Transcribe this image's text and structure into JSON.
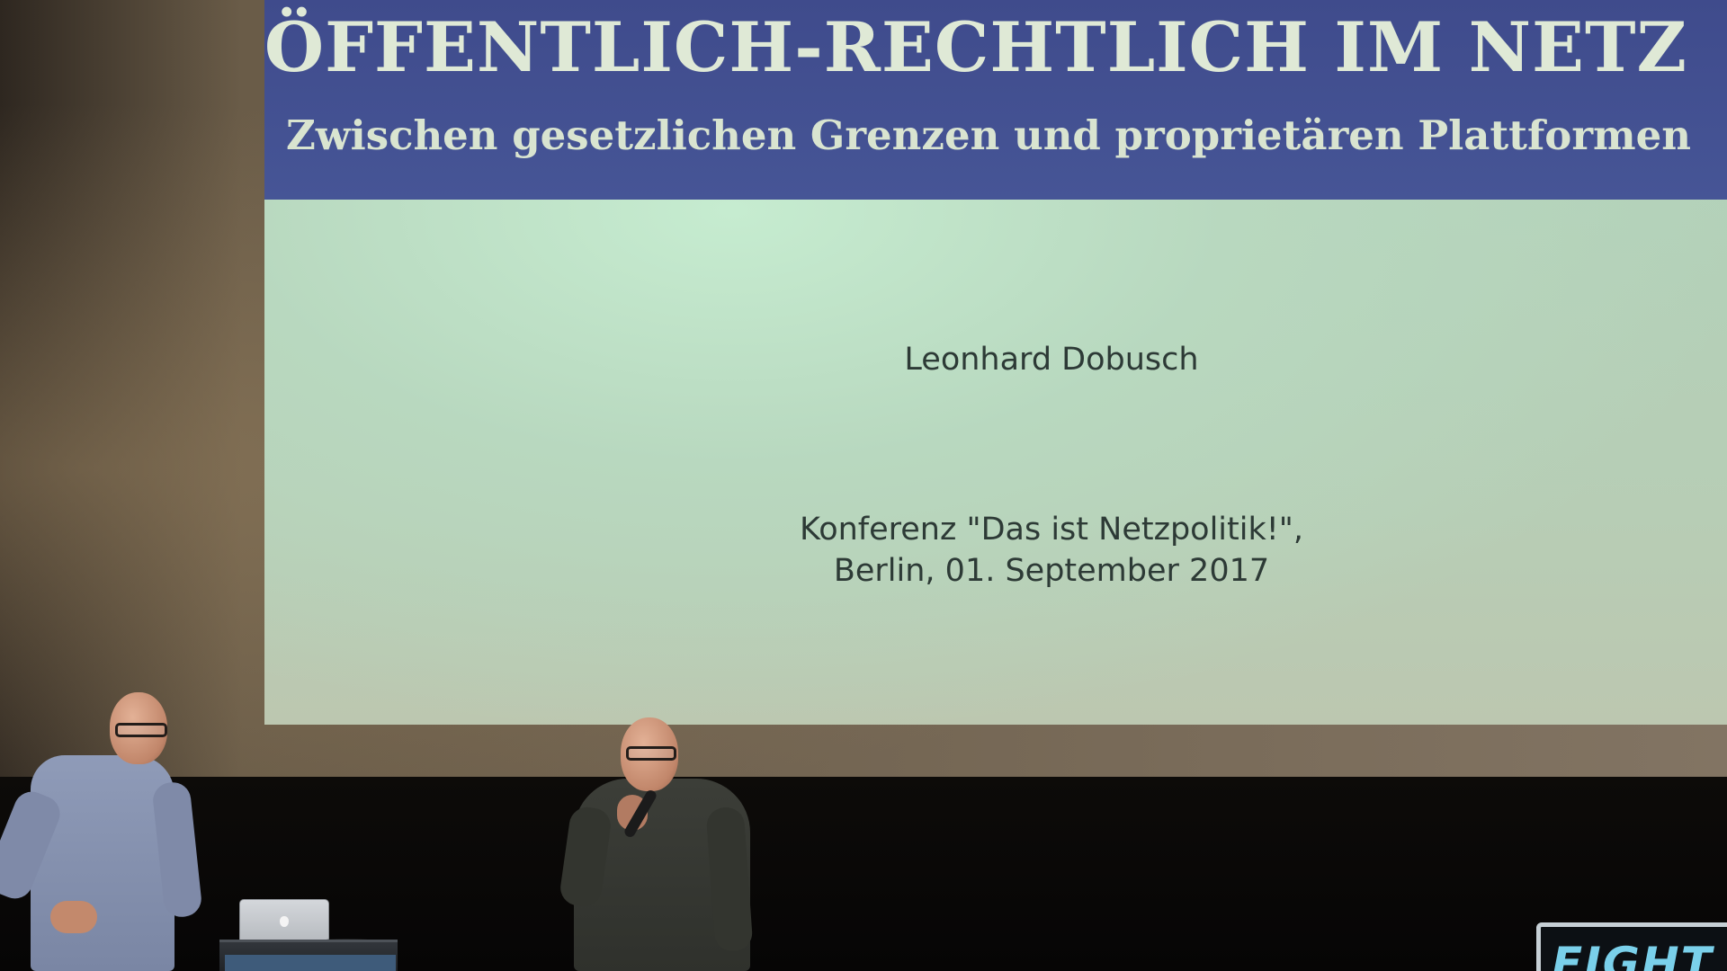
{
  "slide": {
    "title": "ÖFFENTLICH-RECHTLICH IM NETZ",
    "subtitle": "Zwischen gesetzlichen Grenzen und proprietären Plattformen",
    "author": "Leonhard Dobusch",
    "event_line_1": "Konferenz \"Das ist Netzpolitik!\",",
    "event_line_2": "Berlin, 01. September 2017"
  },
  "banner": {
    "text": "FIGHT"
  },
  "colors": {
    "slide_header": "#44529a",
    "slide_title_text": "#dfe9d6",
    "slide_body": "#b7d3bc",
    "slide_body_text": "#2d3a36",
    "banner_text": "#7ad0ea"
  }
}
